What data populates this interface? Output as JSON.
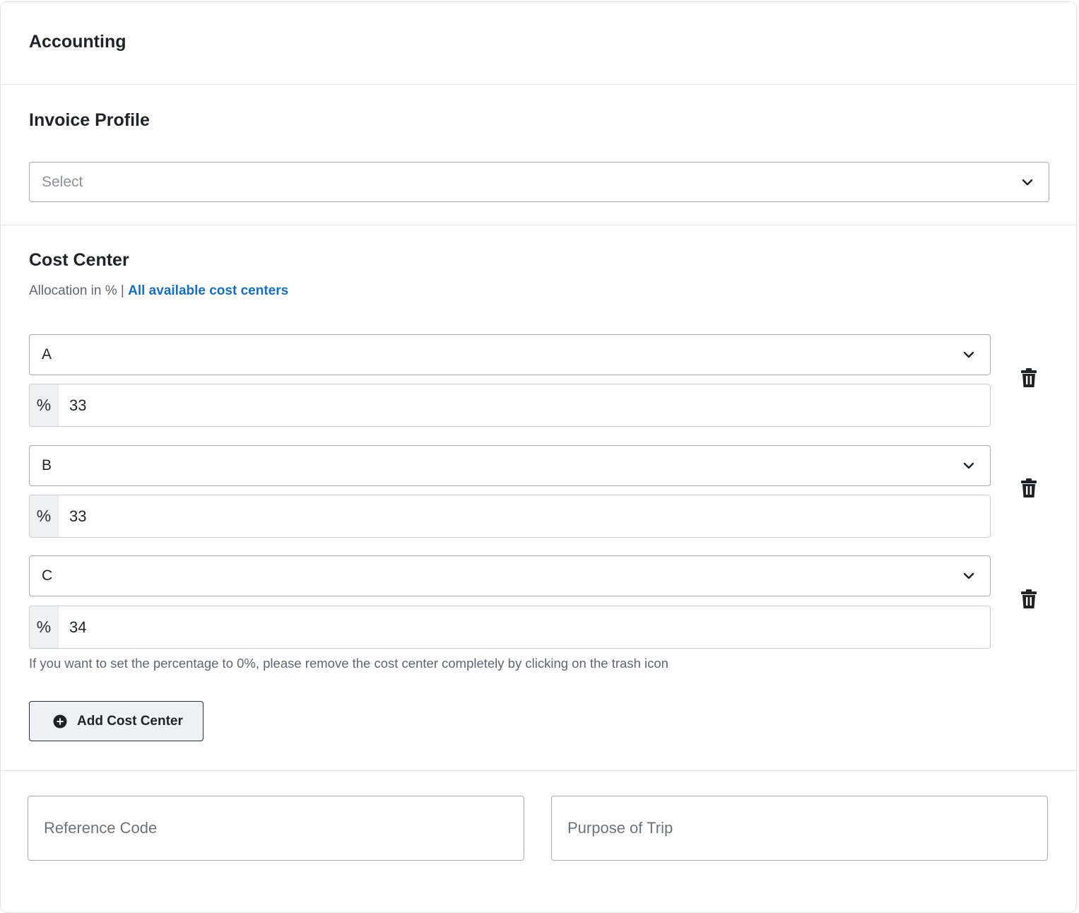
{
  "accounting": {
    "title": "Accounting"
  },
  "invoice_profile": {
    "title": "Invoice Profile",
    "select_placeholder": "Select"
  },
  "cost_center": {
    "title": "Cost Center",
    "allocation_label": "Allocation in % |",
    "all_link": "All available cost centers",
    "percent_symbol": "%",
    "entries": [
      {
        "name": "A",
        "percent": "33"
      },
      {
        "name": "B",
        "percent": "33"
      },
      {
        "name": "C",
        "percent": "34"
      }
    ],
    "hint": "If you want to set the percentage to 0%, please remove the cost center completely by clicking on the trash icon",
    "add_button_label": "Add Cost Center"
  },
  "trip": {
    "reference_code_placeholder": "Reference Code",
    "purpose_placeholder": "Purpose of Trip"
  },
  "icons": {
    "select_chevron": "chevron-down-icon",
    "delete": "trash-icon",
    "add": "plus-circle-icon"
  },
  "colors": {
    "link": "#1a6eb5",
    "border": "#a7aab0",
    "button_bg": "#eef1f5",
    "addon_bg": "#f0f1f3"
  }
}
